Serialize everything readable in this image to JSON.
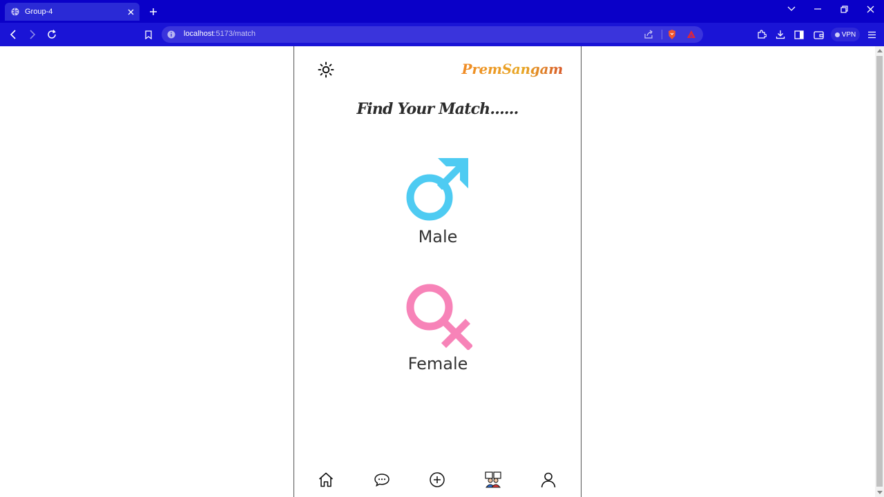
{
  "browser": {
    "tab": {
      "title": "Group-4",
      "favicon": "globe-icon"
    },
    "url": {
      "host": "localhost",
      "path": ":5173/match"
    },
    "vpn_label": "VPN"
  },
  "app": {
    "brand": "PremSangam",
    "theme_toggle_icon": "sun-icon",
    "heading": "Find Your Match......",
    "options": [
      {
        "label": "Male",
        "icon": "male-symbol-icon",
        "color": "#4ecbf2"
      },
      {
        "label": "Female",
        "icon": "female-symbol-icon",
        "color": "#f783b8"
      }
    ],
    "bottom_nav": [
      {
        "icon": "home-icon"
      },
      {
        "icon": "chat-icon"
      },
      {
        "icon": "add-circle-icon"
      },
      {
        "icon": "couple-icon"
      },
      {
        "icon": "profile-icon"
      }
    ]
  }
}
